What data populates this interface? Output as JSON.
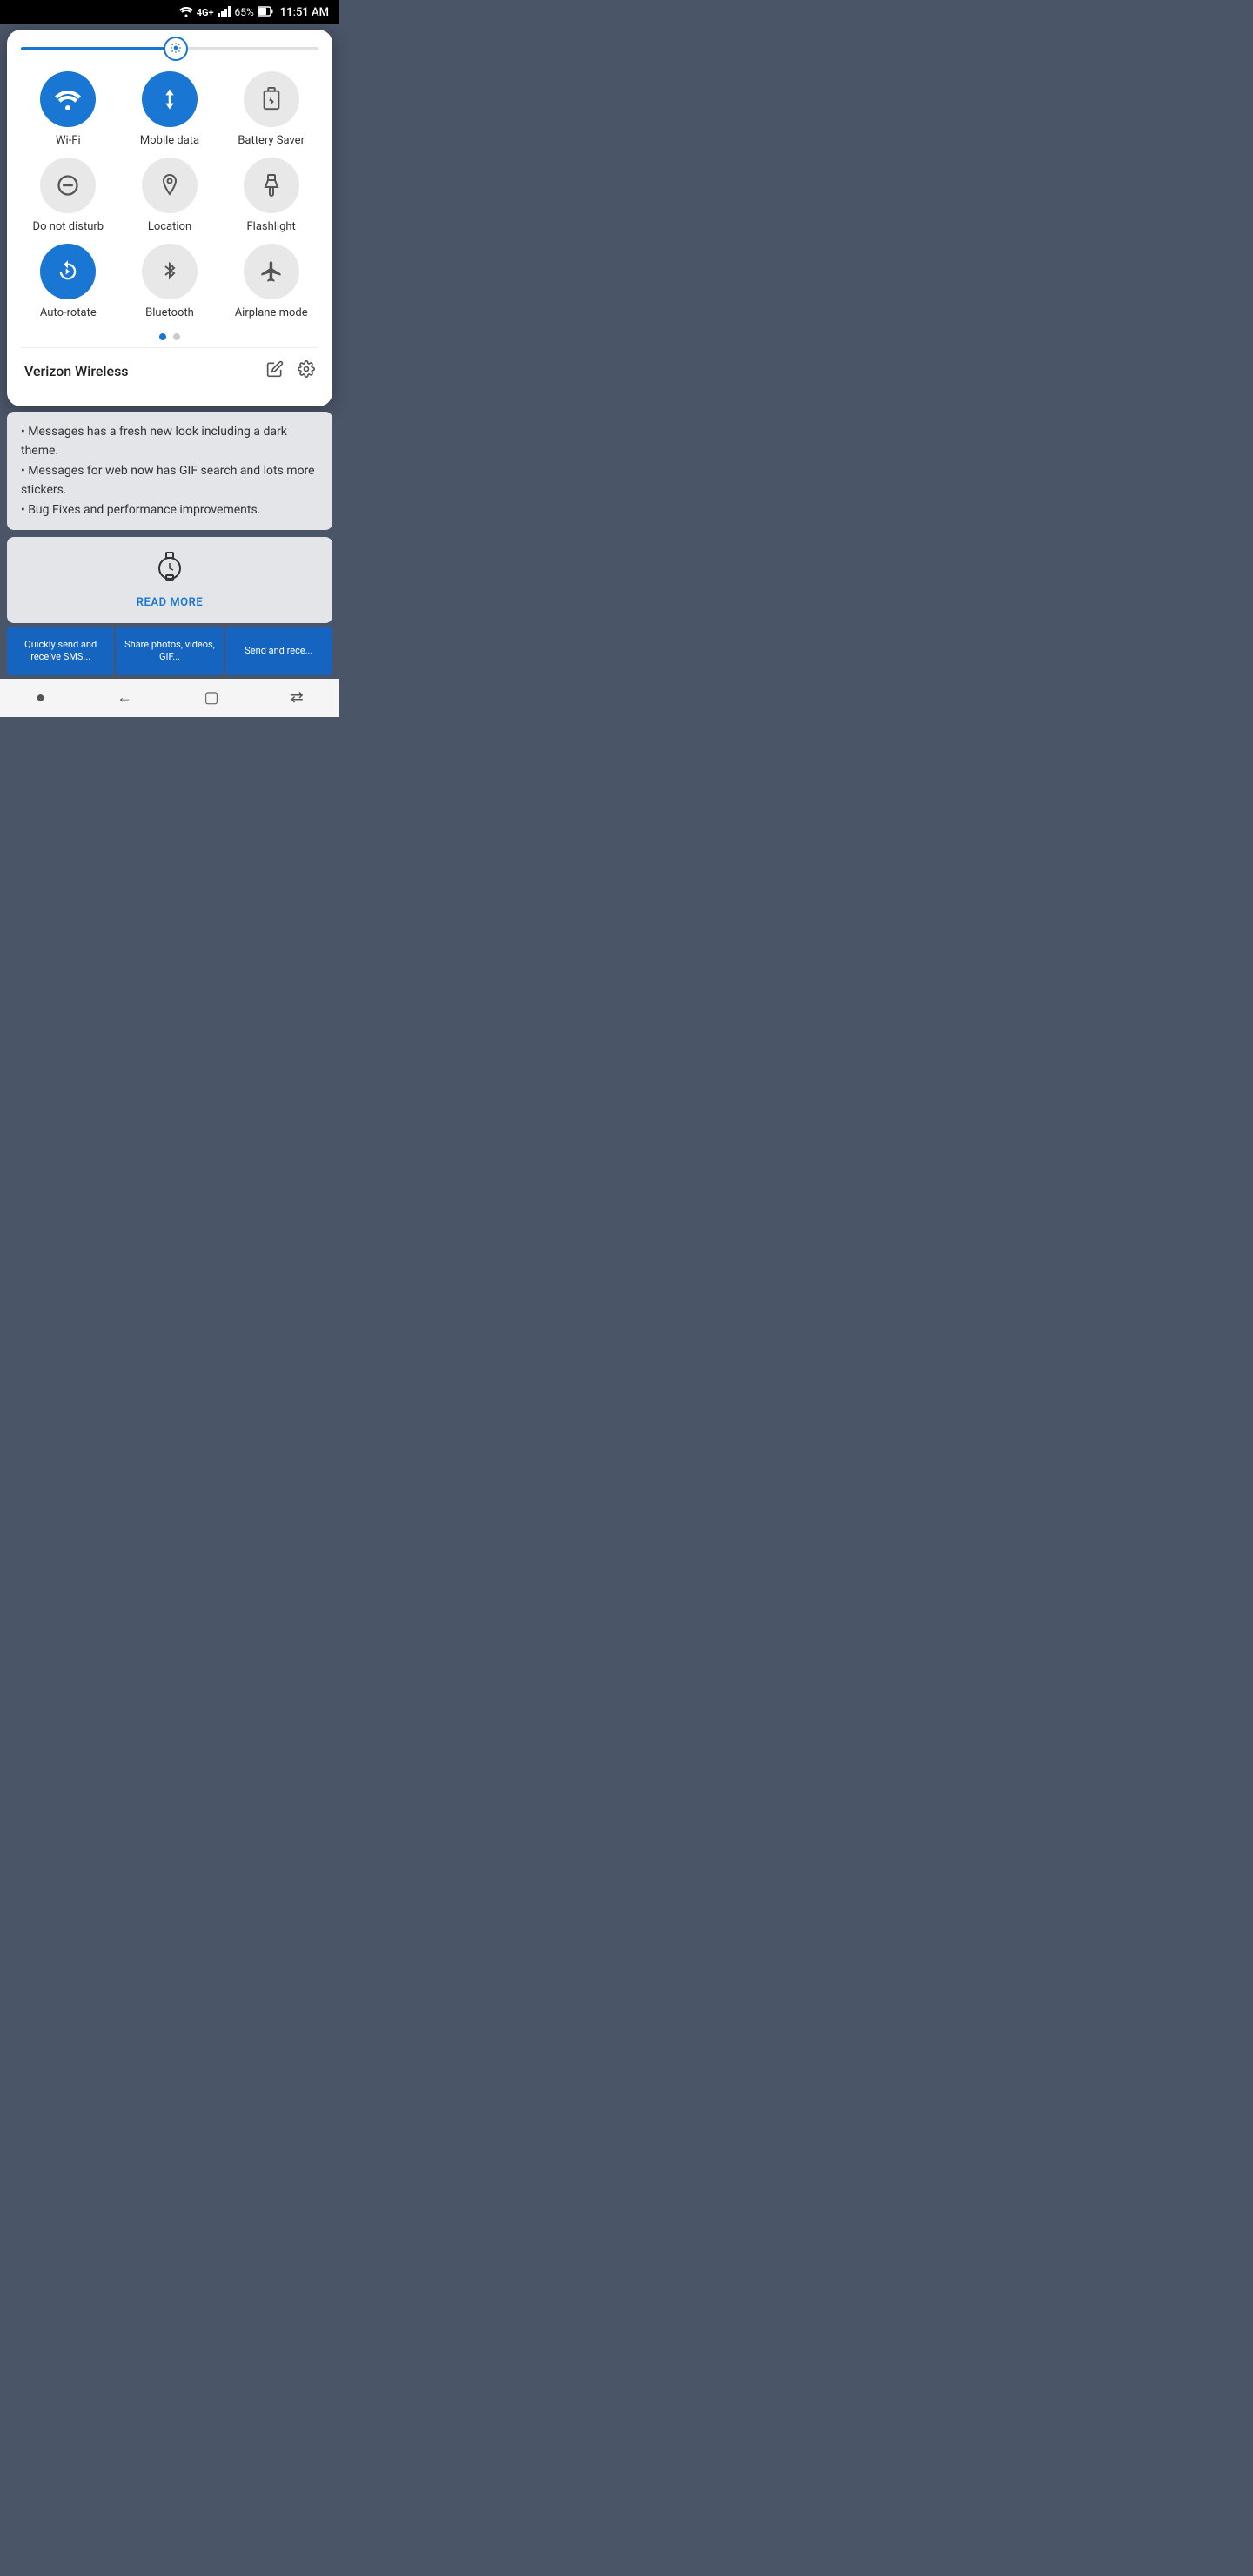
{
  "statusBar": {
    "wifi": "wifi",
    "cellular": "4G+",
    "signal": "signal",
    "battery": "65%",
    "time": "11:51 AM"
  },
  "brightness": {
    "value": 52
  },
  "toggles": [
    {
      "id": "wifi",
      "label": "Wi-Fi",
      "active": true,
      "icon": "wifi"
    },
    {
      "id": "mobile-data",
      "label": "Mobile data",
      "active": true,
      "icon": "mobile-data"
    },
    {
      "id": "battery-saver",
      "label": "Battery Saver",
      "active": false,
      "icon": "battery-saver"
    },
    {
      "id": "do-not-disturb",
      "label": "Do not disturb",
      "active": false,
      "icon": "do-not-disturb"
    },
    {
      "id": "location",
      "label": "Location",
      "active": false,
      "icon": "location"
    },
    {
      "id": "flashlight",
      "label": "Flashlight",
      "active": false,
      "icon": "flashlight"
    },
    {
      "id": "auto-rotate",
      "label": "Auto-rotate",
      "active": true,
      "icon": "auto-rotate"
    },
    {
      "id": "bluetooth",
      "label": "Bluetooth",
      "active": false,
      "icon": "bluetooth"
    },
    {
      "id": "airplane-mode",
      "label": "Airplane mode",
      "active": false,
      "icon": "airplane-mode"
    }
  ],
  "pagination": {
    "current": 0,
    "total": 2
  },
  "carrier": {
    "name": "Verizon Wireless",
    "edit_label": "edit",
    "settings_label": "settings"
  },
  "bgContent": {
    "bullet1": "• Messages has a fresh new look including a dark theme.",
    "bullet2": "• Messages for web now has GIF search and lots more stickers.",
    "bullet3": "• Bug Fixes and performance improvements."
  },
  "readMore": {
    "label": "READ MORE"
  },
  "bottomCards": [
    {
      "text": "Quickly send and receive SMS..."
    },
    {
      "text": "Share photos, videos, GIF..."
    },
    {
      "text": "Send and rece..."
    }
  ],
  "navBar": {
    "home": "●",
    "back": "←",
    "recents": "▢",
    "forward": "⇄"
  }
}
